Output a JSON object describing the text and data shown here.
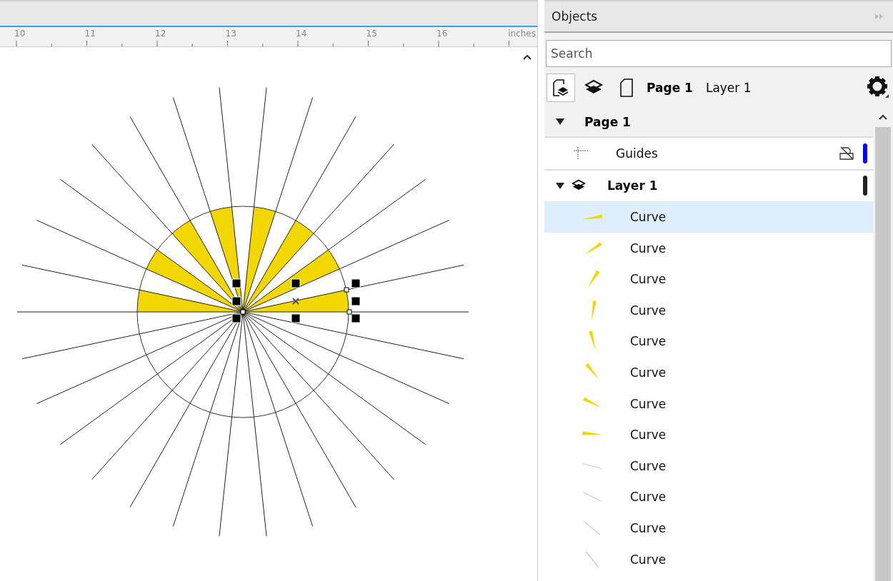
{
  "ruler": {
    "labels": [
      "10",
      "11",
      "12",
      "13",
      "14",
      "15",
      "16"
    ],
    "unit": "inches"
  },
  "objects_panel": {
    "title": "Objects",
    "search": {
      "placeholder": "Search"
    },
    "toolbar": {
      "view_buttons": [
        {
          "kind": "page-layers",
          "selected": true
        },
        {
          "kind": "layers",
          "selected": false
        },
        {
          "kind": "page",
          "selected": false
        }
      ],
      "page_label": "Page 1",
      "layer_label": "Layer 1"
    },
    "tree": [
      {
        "label": "Page 1",
        "expanded": true,
        "children": [
          {
            "kind": "guides",
            "label": "Guides",
            "color": "#0000ff"
          },
          {
            "kind": "layer",
            "label": "Layer 1",
            "expanded": true,
            "color": "#222222",
            "children": [
              {
                "label": "Curve",
                "kind": "wedge",
                "selected": true
              },
              {
                "label": "Curve",
                "kind": "wedge",
                "selected": false
              },
              {
                "label": "Curve",
                "kind": "wedge",
                "selected": false
              },
              {
                "label": "Curve",
                "kind": "wedge",
                "selected": false
              },
              {
                "label": "Curve",
                "kind": "wedge",
                "selected": false
              },
              {
                "label": "Curve",
                "kind": "wedge",
                "selected": false
              },
              {
                "label": "Curve",
                "kind": "wedge",
                "selected": false
              },
              {
                "label": "Curve",
                "kind": "wedge",
                "selected": false
              },
              {
                "label": "Curve",
                "kind": "line",
                "selected": false
              },
              {
                "label": "Curve",
                "kind": "line",
                "selected": false
              },
              {
                "label": "Curve",
                "kind": "line",
                "selected": false
              },
              {
                "label": "Curve",
                "kind": "line",
                "selected": false
              }
            ]
          }
        ]
      }
    ]
  }
}
